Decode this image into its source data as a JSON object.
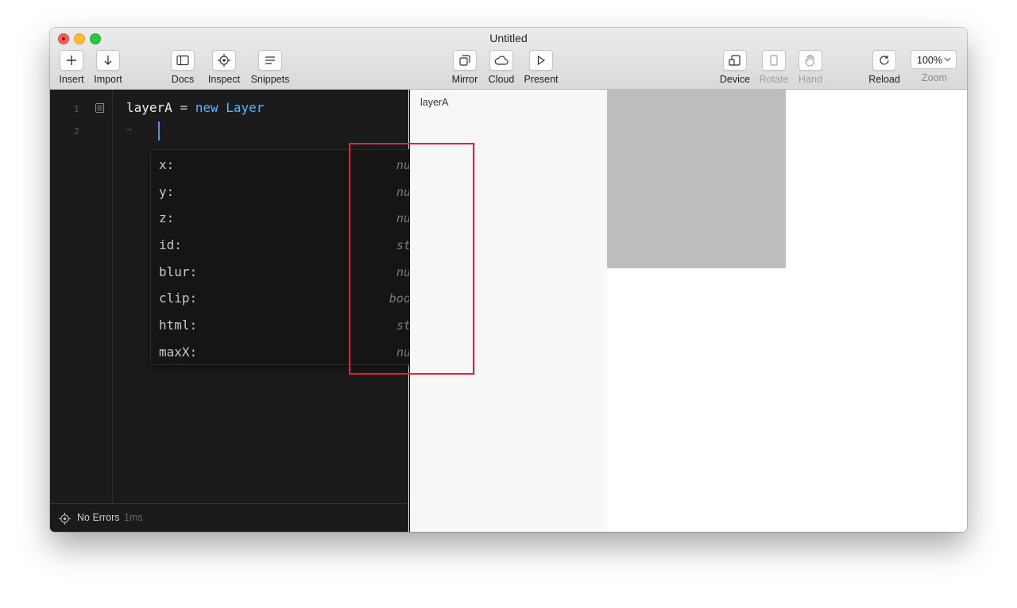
{
  "window": {
    "title": "Untitled"
  },
  "toolbar": {
    "insert": "Insert",
    "import": "Import",
    "docs": "Docs",
    "inspect": "Inspect",
    "snippets": "Snippets",
    "mirror": "Mirror",
    "cloud": "Cloud",
    "present": "Present",
    "device": "Device",
    "rotate": "Rotate",
    "hand": "Hand",
    "reload": "Reload",
    "zoom_label": "Zoom",
    "zoom_value": "100%"
  },
  "editor": {
    "line_numbers": [
      "1",
      "2"
    ],
    "line1": {
      "var": "layerA",
      "op": "=",
      "kw": "new",
      "cls": "Layer"
    },
    "line2_marker": "¬",
    "autocomplete": [
      {
        "name": "x:",
        "type": "number"
      },
      {
        "name": "y:",
        "type": "number"
      },
      {
        "name": "z:",
        "type": "number"
      },
      {
        "name": "id:",
        "type": "string"
      },
      {
        "name": "blur:",
        "type": "number"
      },
      {
        "name": "clip:",
        "type": "boolean"
      },
      {
        "name": "html:",
        "type": "string"
      },
      {
        "name": "maxX:",
        "type": "number"
      }
    ],
    "status": {
      "text": "No Errors",
      "time": "1ms"
    }
  },
  "layers_panel": {
    "items": [
      "layerA"
    ]
  },
  "colors": {
    "highlight": "#e0223a",
    "keyword": "#56b6ff",
    "layer_fill": "#bdbdbd"
  }
}
